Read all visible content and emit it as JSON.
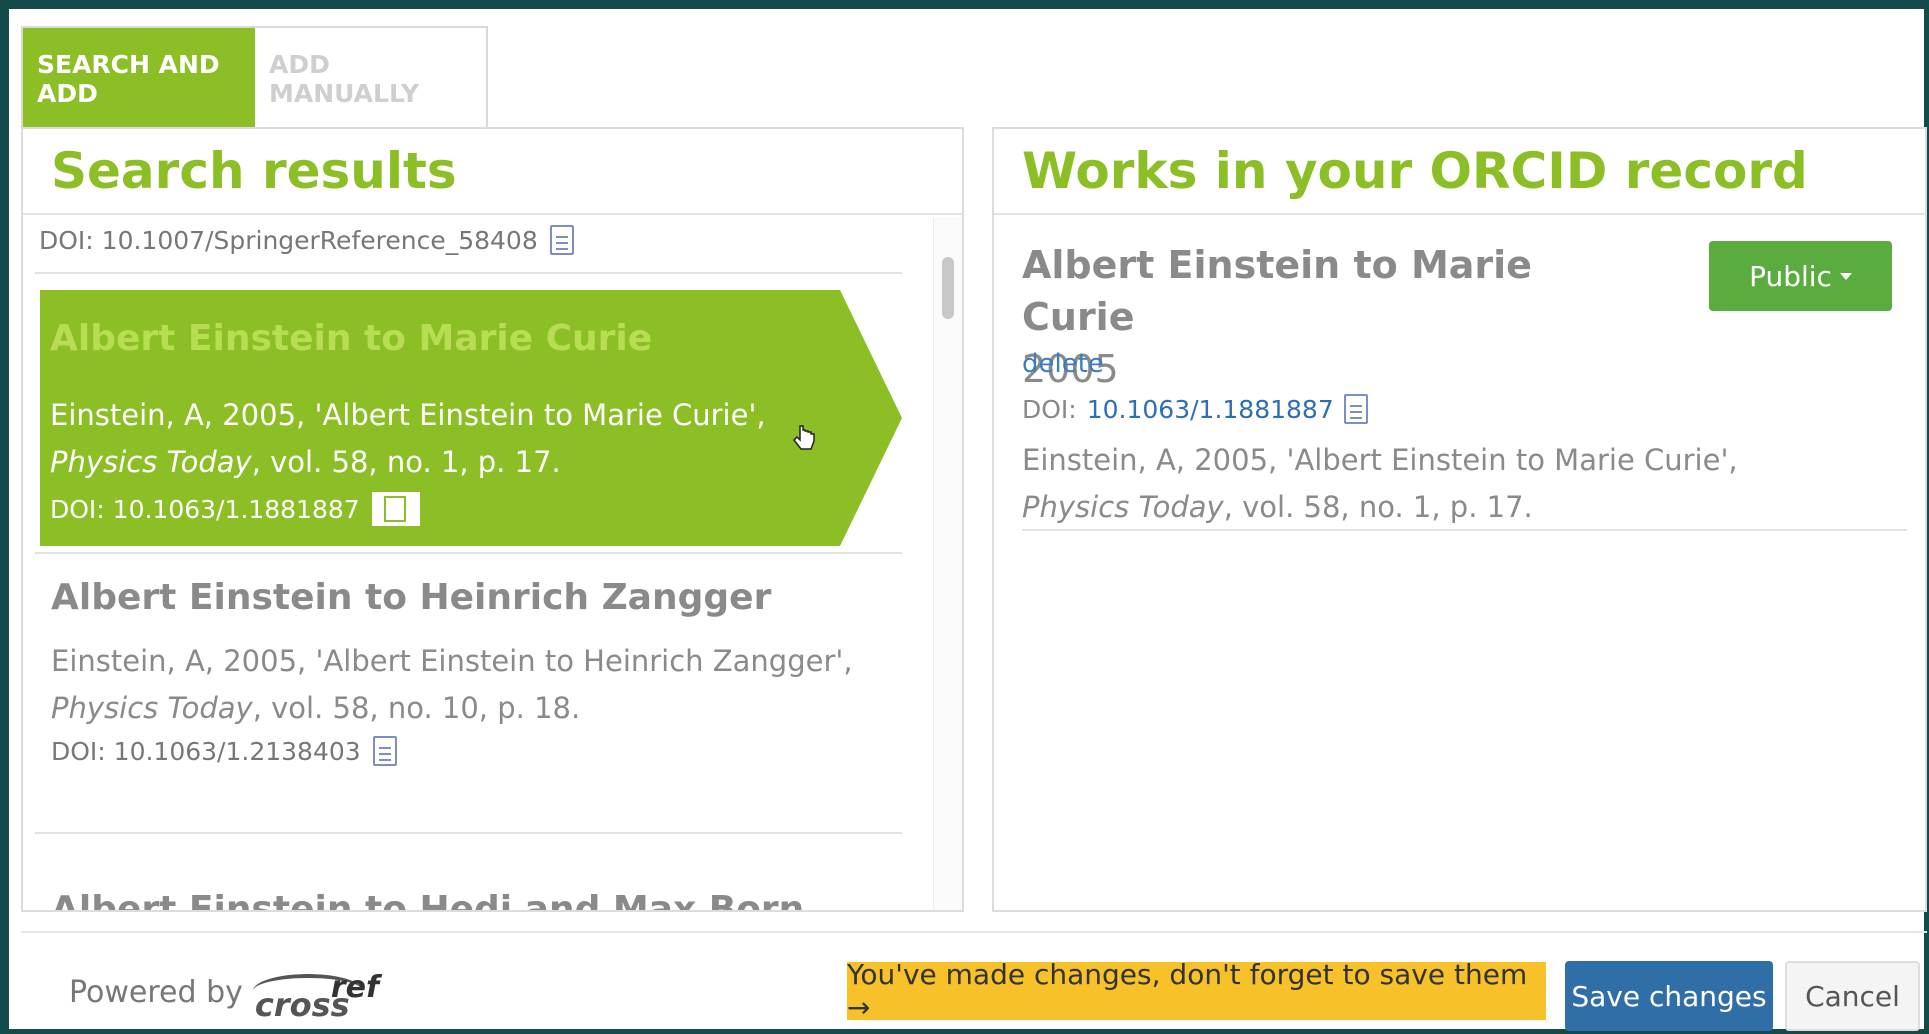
{
  "tabs": {
    "search_add": "SEARCH AND ADD",
    "add_manually": "ADD MANUALLY"
  },
  "left_panel": {
    "title": "Search results",
    "prev_doi_label": "DOI: 10.1007/SpringerReference_58408",
    "selected_item": {
      "title": "Albert Einstein to Marie Curie",
      "citation_prefix": "Einstein, A, 2005, 'Albert Einstein to Marie Curie', ",
      "citation_journal": "Physics Today",
      "citation_suffix": ", vol. 58, no. 1, p. 17.",
      "doi_label": "DOI: 10.1063/1.1881887"
    },
    "item2": {
      "title": "Albert Einstein to Heinrich Zangger",
      "citation_prefix": "Einstein, A, 2005, 'Albert Einstein to Heinrich Zangger',",
      "citation_journal": "Physics Today",
      "citation_suffix": ", vol. 58, no. 10, p. 18.",
      "doi_label": "DOI: 10.1063/1.2138403"
    },
    "item3_partial_title": "Albert Einstein to Hedi and Max Born"
  },
  "right_panel": {
    "title": "Works in your ORCID record",
    "work": {
      "title": "Albert Einstein to Marie Curie",
      "year": "2005",
      "delete_label": "delete",
      "doi_prefix": "DOI:",
      "doi_link": "10.1063/1.1881887",
      "citation_prefix": "Einstein, A, 2005, 'Albert Einstein to Marie Curie',",
      "citation_journal": "Physics Today",
      "citation_suffix": ", vol. 58, no. 1, p. 17.",
      "visibility_label": "Public"
    }
  },
  "footer": {
    "powered_by": "Powered by",
    "logo_text_left": "cross",
    "logo_text_right": "ref",
    "notice": "You've made changes, don't forget to save them →",
    "save_label": "Save changes",
    "cancel_label": "Cancel"
  },
  "colors": {
    "brand_green": "#8cbf26",
    "public_green": "#5aac3f",
    "save_blue": "#2f6ea7",
    "notice_yellow": "#f7c12a",
    "link_blue": "#3a7ec1",
    "frame_teal": "#134a4a"
  },
  "icons": {
    "document": "document-icon",
    "caret": "caret-down-icon",
    "cursor": "hand-pointer-icon"
  }
}
